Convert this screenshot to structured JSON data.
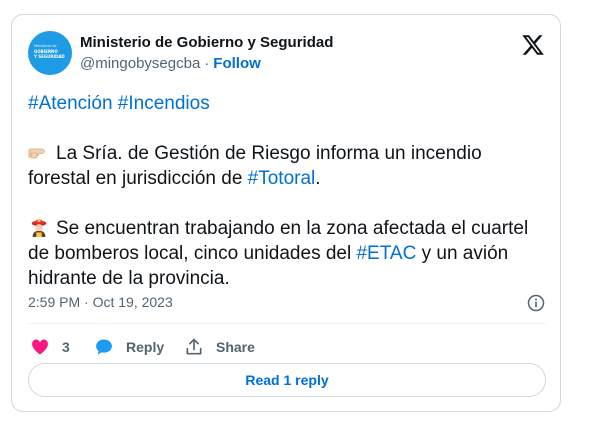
{
  "author": {
    "name": "Ministerio de Gobierno y Seguridad",
    "handle": "@mingobysegcba",
    "separator": "·",
    "follow_label": "Follow",
    "avatar_line1": "Ministerio de",
    "avatar_line2": "GOBIERNO",
    "avatar_line3": "Y SEGURIDAD"
  },
  "tweet": {
    "p1": {
      "tag1": "#Atención",
      "space": " ",
      "tag2": "#Incendios"
    },
    "p2": {
      "text": "La Sría. de Gestión de Riesgo informa un incendio forestal en jurisdicción de ",
      "tag": "#Totoral",
      "tail": "."
    },
    "p3": {
      "text": "Se encuentran trabajando en la zona afectada el cuartel de bomberos local, cinco unidades del ",
      "tag": "#ETAC",
      "tail": " y un avión hidrante de la provincia."
    }
  },
  "meta": {
    "time": "2:59 PM",
    "separator": "·",
    "date": "Oct 19, 2023"
  },
  "actions": {
    "likes": "3",
    "reply_label": "Reply",
    "share_label": "Share"
  },
  "read_replies_label": "Read 1 reply",
  "colors": {
    "accent": "#006fd6",
    "like": "#f91880",
    "reply": "#1d9bf0"
  },
  "icons": [
    "x-logo-icon",
    "pointing-hand-icon",
    "firefighter-icon",
    "info-icon",
    "heart-icon",
    "reply-bubble-icon",
    "share-icon"
  ]
}
